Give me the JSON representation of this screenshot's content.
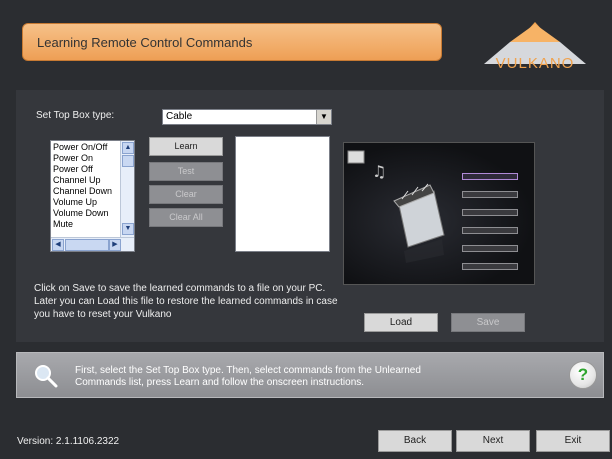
{
  "header": {
    "title": "Learning Remote Control Commands",
    "logo_text": "VULKANO"
  },
  "stb": {
    "label": "Set Top Box type:",
    "selected": "Cable"
  },
  "commands": {
    "items": [
      "Power On/Off",
      "Power On",
      "Power Off",
      "Channel Up",
      "Channel Down",
      "Volume Up",
      "Volume Down",
      "Mute"
    ]
  },
  "buttons": {
    "learn": "Learn",
    "test": "Test",
    "clear": "Clear",
    "clear_all": "Clear All",
    "load": "Load",
    "save": "Save"
  },
  "info": {
    "text": "Click on Save to save the learned commands to a file on your PC. Later you can Load this file to restore the learned commands in case you have to reset your Vulkano"
  },
  "hint": {
    "text": "First, select the Set Top Box type. Then, select commands from the Unlearned Commands list, press Learn and follow the onscreen instructions."
  },
  "footer": {
    "version": "Version: 2.1.1106.2322",
    "back": "Back",
    "next": "Next",
    "exit": "Exit"
  },
  "icons": {
    "search": "magnifier-icon",
    "help": "?"
  },
  "colors": {
    "accent": "#ee9f55",
    "background": "#2b2d31",
    "help_green": "#2fa52f"
  }
}
